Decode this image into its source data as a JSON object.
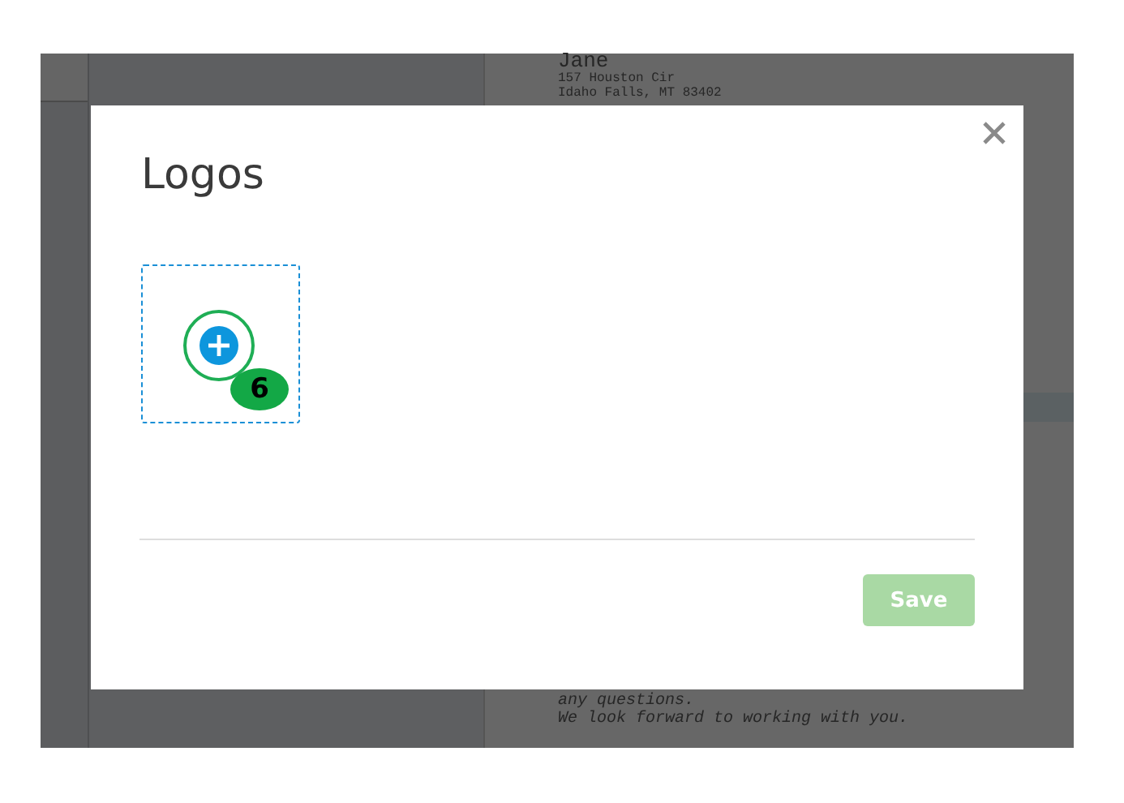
{
  "background_document": {
    "recipient_name": "Jane",
    "address_lines": [
      "157 Houston Cir",
      "Idaho Falls, MT 83402"
    ],
    "closing_lines": [
      "any questions.",
      "We look forward to working with you."
    ]
  },
  "dialog": {
    "title": "Logos",
    "upload_tile": {
      "badge": "6"
    },
    "save_button": {
      "label": "Save",
      "disabled": true
    }
  }
}
